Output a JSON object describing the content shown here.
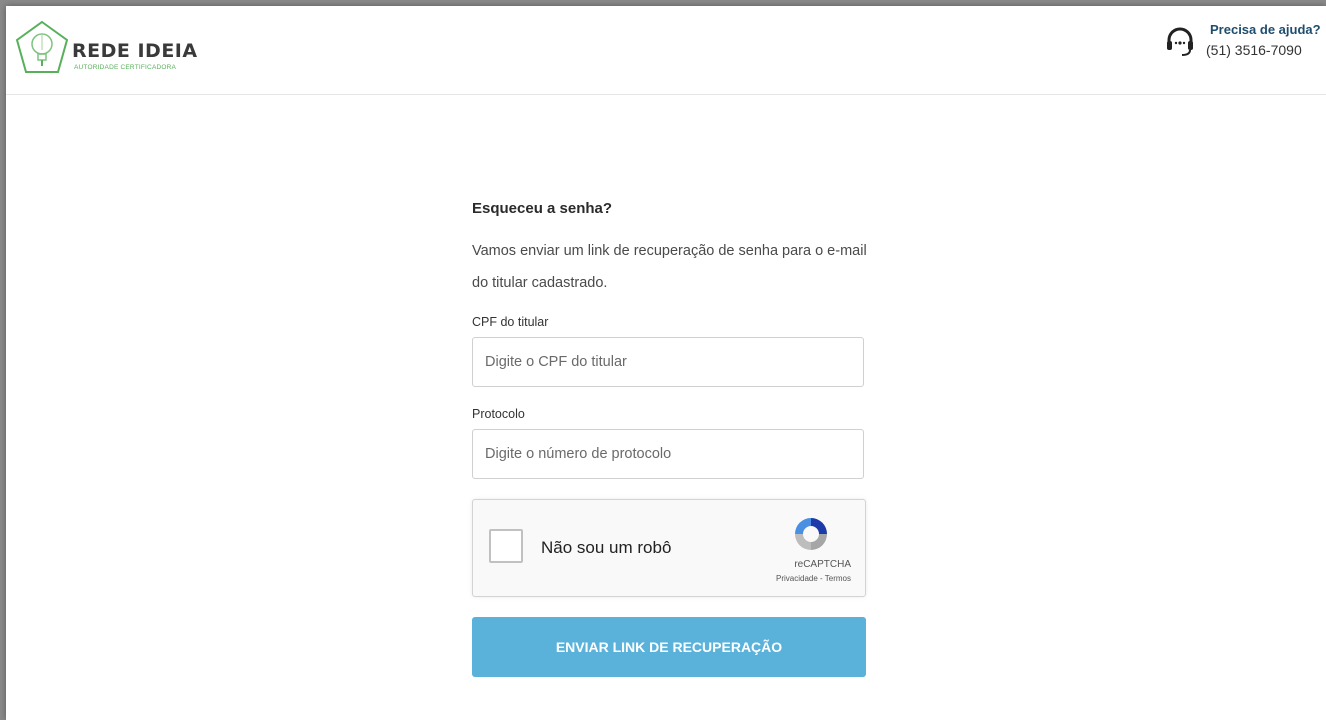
{
  "header": {
    "logo_title": "REDE IDEIA",
    "logo_subtitle": "AUTORIDADE CERTIFICADORA",
    "help_title": "Precisa de ajuda?",
    "help_phone": "(51) 3516-7090",
    "icons": {
      "logo": "lightbulb-pentagon-logo",
      "help": "headset-icon"
    }
  },
  "form": {
    "title": "Esqueceu a senha?",
    "description": "Vamos enviar um link de recuperação de senha para o e-mail do titular cadastrado.",
    "cpf_label": "CPF do titular",
    "cpf_placeholder": "Digite o CPF do titular",
    "cpf_value": "",
    "protocol_label": "Protocolo",
    "protocol_placeholder": "Digite o número de protocolo",
    "protocol_value": "",
    "submit_label": "ENVIAR LINK DE RECUPERAÇÃO"
  },
  "recaptcha": {
    "label": "Não sou um robô",
    "brand": "reCAPTCHA",
    "links": "Privacidade - Termos",
    "checked": false
  },
  "colors": {
    "button": "#5ab2db",
    "logo_green": "#58b05a",
    "help_title": "#1f4d6e"
  }
}
